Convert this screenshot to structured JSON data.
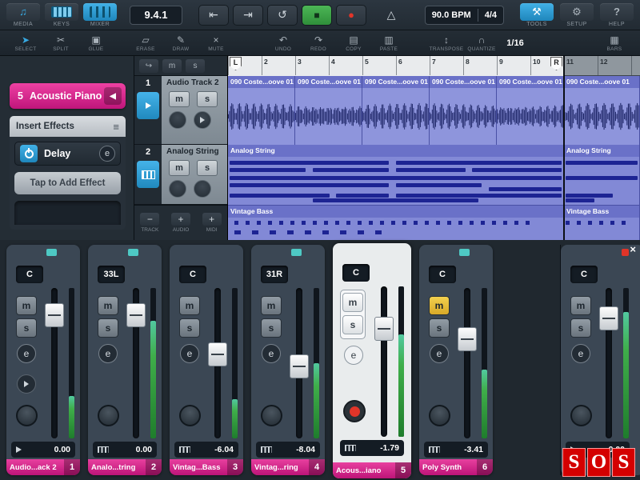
{
  "icons": {
    "media": "♫",
    "prev": "⇤",
    "next": "⇥",
    "cycle": "↺",
    "stop": "■",
    "record": "●",
    "metronome": "△",
    "tools": "⚒",
    "setup": "⚙",
    "help": "?",
    "select": "➤",
    "split": "✂",
    "glue": "▣",
    "erase": "▱",
    "draw": "✎",
    "mute": "×",
    "undo": "↶",
    "redo": "↷",
    "copy": "▤",
    "paste": "▥",
    "transpose": "↕",
    "quantize": "∩",
    "bars": "▦",
    "preset_prev": "◀",
    "fx_settings": "≡",
    "minus": "−",
    "plus": "+",
    "close": "×",
    "follow": "↪"
  },
  "labels": {
    "mute": "m",
    "solo": "s",
    "edit": "e"
  },
  "topbar": {
    "media": "MEDIA",
    "keys": "KEYS",
    "mixer": "MIXER",
    "time_display": "9.4.1",
    "bpm": "90.0 BPM",
    "time_sig": "4/4",
    "tools": "TOOLS",
    "setup": "SETUP",
    "help": "HELP"
  },
  "toolbar": {
    "select": "SELECT",
    "split": "SPLIT",
    "glue": "GLUE",
    "erase": "ERASE",
    "draw": "DRAW",
    "mute": "MUTE",
    "undo": "UNDO",
    "redo": "REDO",
    "copy": "COPY",
    "paste": "PASTE",
    "transpose": "TRANSPOSE",
    "quantize": "QUANTIZE",
    "grid_value": "1/16",
    "bars": "BARS"
  },
  "inspector": {
    "track_number": "5",
    "track_name": "Acoustic Piano",
    "insert_effects_title": "Insert Effects",
    "effect_slot": "Delay",
    "add_effect": "Tap to Add Effect"
  },
  "tracklist": {
    "tracks": [
      {
        "num": "1",
        "name": "Audio Track 2"
      },
      {
        "num": "2",
        "name": "Analog String"
      }
    ],
    "track_btn": "TRACK",
    "audio_btn": "AUDIO",
    "midi_btn": "MIDI"
  },
  "timeline": {
    "ruler_numbers": [
      "2",
      "3",
      "4",
      "5",
      "6",
      "7",
      "8",
      "9",
      "10",
      "11",
      "12"
    ],
    "loop_start": "L",
    "loop_end": "R",
    "audio_clips": [
      "090 Coste...oove 01",
      "090 Coste...oove 01",
      "090 Coste...oove 01",
      "090 Coste...oove 01",
      "090 Coste...oove 01",
      "090 Coste...oove 01"
    ],
    "string_clip": "Analog String",
    "bass_clip": "Vintage Bass",
    "string_notes_a": [
      {
        "t": 6,
        "l": 0,
        "w": 48
      },
      {
        "t": 6,
        "l": 50,
        "w": 50
      },
      {
        "t": 22,
        "l": 0,
        "w": 23
      },
      {
        "t": 22,
        "l": 25,
        "w": 23
      },
      {
        "t": 22,
        "l": 50,
        "w": 21
      },
      {
        "t": 22,
        "l": 73,
        "w": 27
      },
      {
        "t": 40,
        "l": 0,
        "w": 100
      },
      {
        "t": 56,
        "l": 0,
        "w": 48
      },
      {
        "t": 56,
        "l": 50,
        "w": 26
      },
      {
        "t": 64,
        "l": 78,
        "w": 22
      },
      {
        "t": 78,
        "l": 0,
        "w": 30
      },
      {
        "t": 78,
        "l": 32,
        "w": 16
      },
      {
        "t": 78,
        "l": 50,
        "w": 50
      },
      {
        "t": 90,
        "l": 25,
        "w": 50
      }
    ],
    "string_notes_b": [
      {
        "t": 6,
        "l": 0,
        "w": 100
      },
      {
        "t": 40,
        "l": 0,
        "w": 100
      },
      {
        "t": 78,
        "l": 0,
        "w": 65
      },
      {
        "t": 90,
        "l": 0,
        "w": 40
      }
    ]
  },
  "mixer": {
    "channels": [
      {
        "pan": "C",
        "db": "0.00",
        "num": "1",
        "label": "Audio...ack 2",
        "fader": 10,
        "meter": 28
      },
      {
        "pan": "33L",
        "db": "0.00",
        "num": "2",
        "label": "Analo...tring",
        "fader": 10,
        "meter": 78
      },
      {
        "pan": "C",
        "db": "-6.04",
        "num": "3",
        "label": "Vintag...Bass",
        "fader": 36,
        "meter": 26
      },
      {
        "pan": "31R",
        "db": "-8.04",
        "num": "4",
        "label": "Vintag...ring",
        "fader": 44,
        "meter": 50
      },
      {
        "pan": "C",
        "db": "-1.79",
        "num": "5",
        "label": "Acous...iano",
        "fader": 20,
        "meter": 68
      },
      {
        "pan": "C",
        "db": "-3.41",
        "num": "6",
        "label": "Poly Synth",
        "fader": 26,
        "meter": 46
      },
      {
        "pan": "C",
        "db": "0.00",
        "num": "",
        "label": "",
        "fader": 12,
        "meter": 84
      }
    ]
  },
  "logo": {
    "letters": [
      "S",
      "O",
      "S"
    ]
  }
}
